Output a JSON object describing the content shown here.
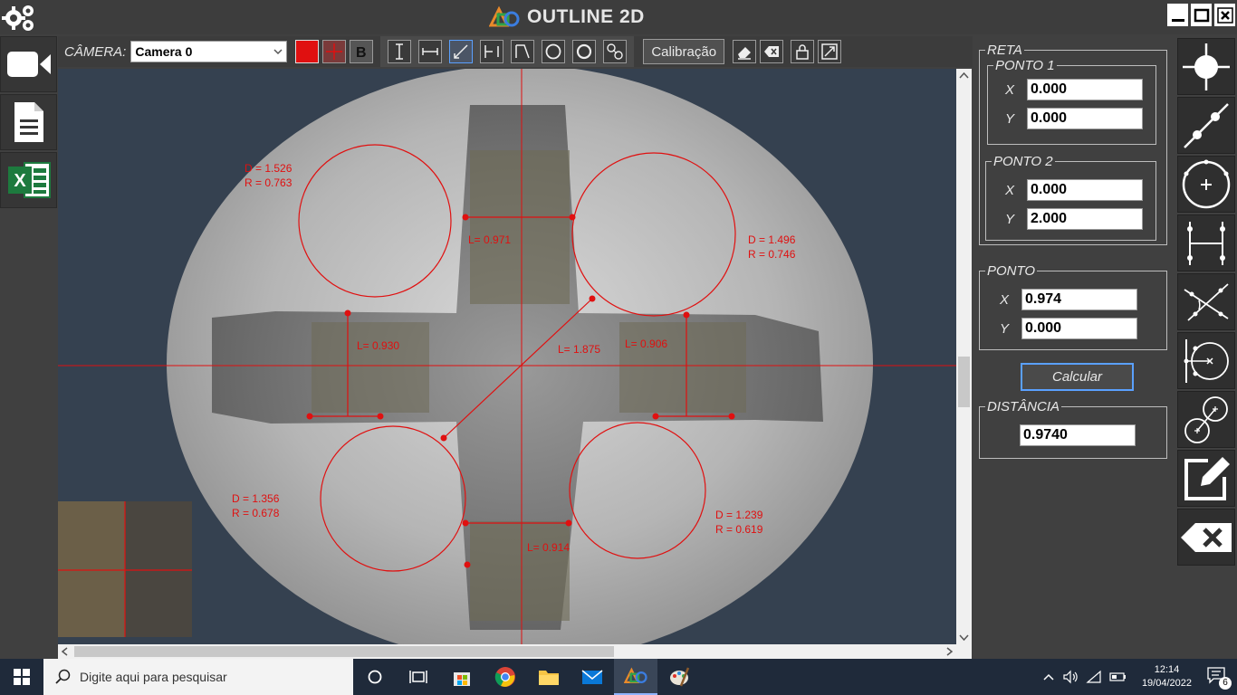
{
  "app": {
    "title": "OUTLINE 2D"
  },
  "toolbar": {
    "camera_label": "CÂMERA:",
    "camera_value": "Camera 0",
    "calibration_label": "Calibração"
  },
  "overlay": {
    "circles": [
      {
        "d": "D = 1.526",
        "r": "R = 0.763"
      },
      {
        "d": "D = 1.496",
        "r": "R = 0.746"
      },
      {
        "d": "D = 1.356",
        "r": "R = 0.678"
      },
      {
        "d": "D = 1.239",
        "r": "R = 0.619"
      }
    ],
    "lengths": [
      "L= 0.971",
      "L= 0.930",
      "L= 1.875",
      "L= 0.906",
      "L= 0.914"
    ]
  },
  "panel": {
    "reta_title": "RETA",
    "ponto1_title": "PONTO 1",
    "ponto1_x_label": "X",
    "ponto1_x": "0.000",
    "ponto1_y_label": "Y",
    "ponto1_y": "0.000",
    "ponto2_title": "PONTO 2",
    "ponto2_x_label": "X",
    "ponto2_x": "0.000",
    "ponto2_y_label": "Y",
    "ponto2_y": "2.000",
    "ponto_title": "PONTO",
    "ponto_x_label": "X",
    "ponto_x": "0.974",
    "ponto_y_label": "Y",
    "ponto_y": "0.000",
    "calculate_label": "Calcular",
    "distance_title": "DISTÂNCIA",
    "distance_value": "0.9740"
  },
  "taskbar": {
    "search_placeholder": "Digite aqui para pesquisar",
    "time": "12:14",
    "date": "19/04/2022",
    "notifications": "6"
  },
  "colors": {
    "accent_red": "#e01010",
    "focus_blue": "#5aa0ff"
  }
}
